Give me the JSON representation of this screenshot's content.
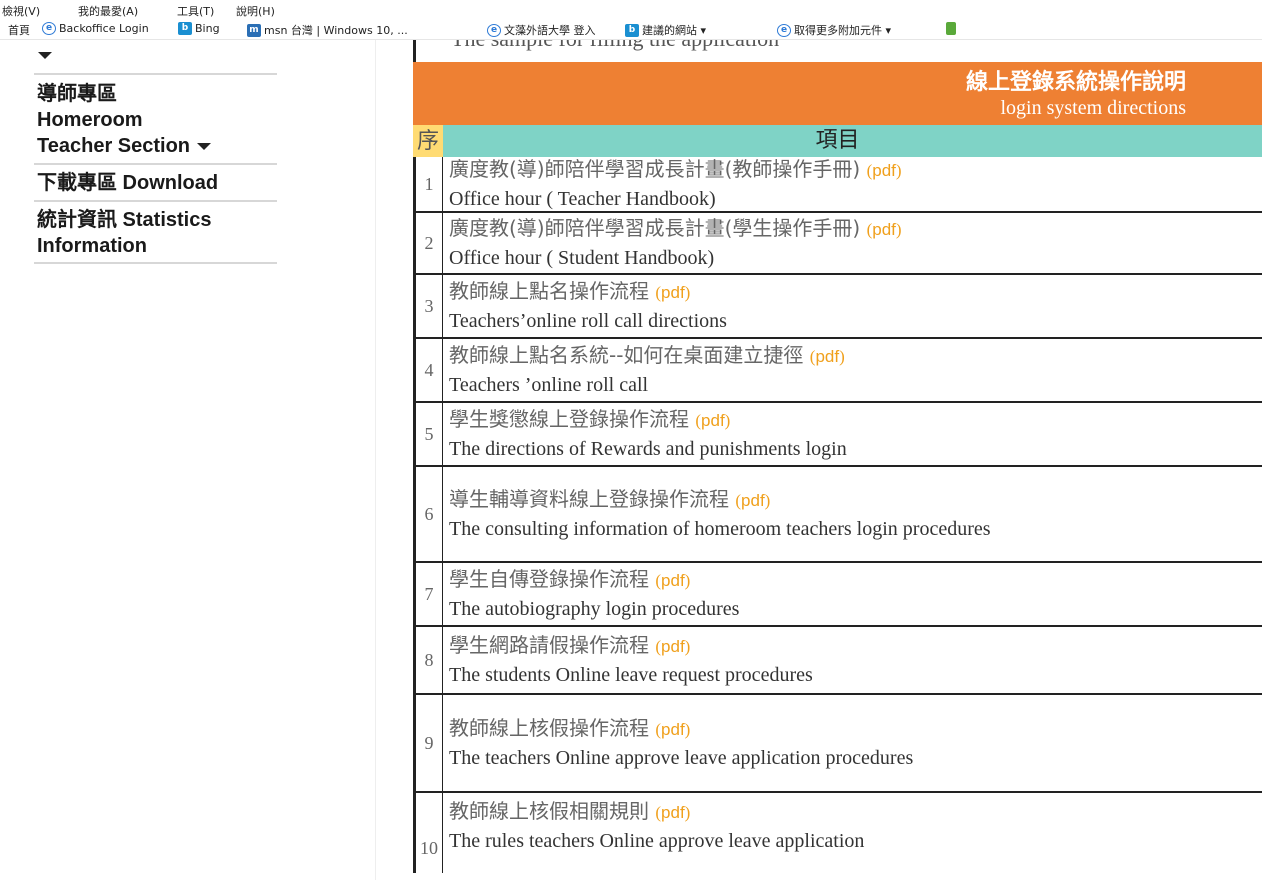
{
  "browser": {
    "menu": [
      "檢視(V)",
      "我的最愛(A)",
      "工具(T)",
      "說明(H)"
    ],
    "favorites": [
      {
        "label": "首頁",
        "icon": "home-text"
      },
      {
        "label": "Backoffice Login",
        "icon": "ie-icon"
      },
      {
        "label": "Bing",
        "icon": "bing-icon"
      },
      {
        "label": "msn 台灣 | Windows 10, ...",
        "icon": "msn-icon"
      },
      {
        "label": "文藻外語大學 登入",
        "icon": "ie-icon"
      },
      {
        "label": "建議的網站 ▾",
        "icon": "bing-icon"
      },
      {
        "label": "取得更多附加元件 ▾",
        "icon": "ie-icon"
      }
    ]
  },
  "sidebar": {
    "items": [
      {
        "label": "導師專區\nHomeroom\nTeacher Section",
        "has_caret": true
      },
      {
        "label": "下載專區 Download"
      },
      {
        "label": "統計資訊 Statistics\nInformation"
      }
    ]
  },
  "table": {
    "cut_row_text": "The sample for filling the application",
    "header_zh": "線上登錄系統操作說明",
    "header_en": "login system directions",
    "col_seq": "序",
    "col_item": "項目",
    "pdf_label": "pdf",
    "rows": [
      {
        "num": "1",
        "zh": "廣度教(導)師陪伴學習成長計畫(教師操作手冊)",
        "en": "Office hour ( Teacher Handbook)"
      },
      {
        "num": "2",
        "zh": "廣度教(導)師陪伴學習成長計畫(學生操作手冊)",
        "en": "Office hour ( Student Handbook)"
      },
      {
        "num": "3",
        "zh": "教師線上點名操作流程",
        "en": "Teachers’online roll call directions"
      },
      {
        "num": "4",
        "zh": "教師線上點名系統--如何在桌面建立捷徑",
        "en": "Teachers ’online roll call"
      },
      {
        "num": "5",
        "zh": "學生獎懲線上登錄操作流程",
        "en": "The directions of Rewards and punishments login"
      },
      {
        "num": "6",
        "zh": "導生輔導資料線上登錄操作流程",
        "en": "The consulting information of homeroom teachers login procedures"
      },
      {
        "num": "7",
        "zh": "學生自傳登錄操作流程",
        "en": "The autobiography login procedures"
      },
      {
        "num": "8",
        "zh": "學生網路請假操作流程",
        "en": "The students Online leave request procedures"
      },
      {
        "num": "9",
        "zh": "教師線上核假操作流程",
        "en": "The teachers Online approve leave application procedures"
      },
      {
        "num": "10",
        "zh": "教師線上核假相關規則",
        "en": "The rules teachers Online approve leave application"
      }
    ]
  }
}
